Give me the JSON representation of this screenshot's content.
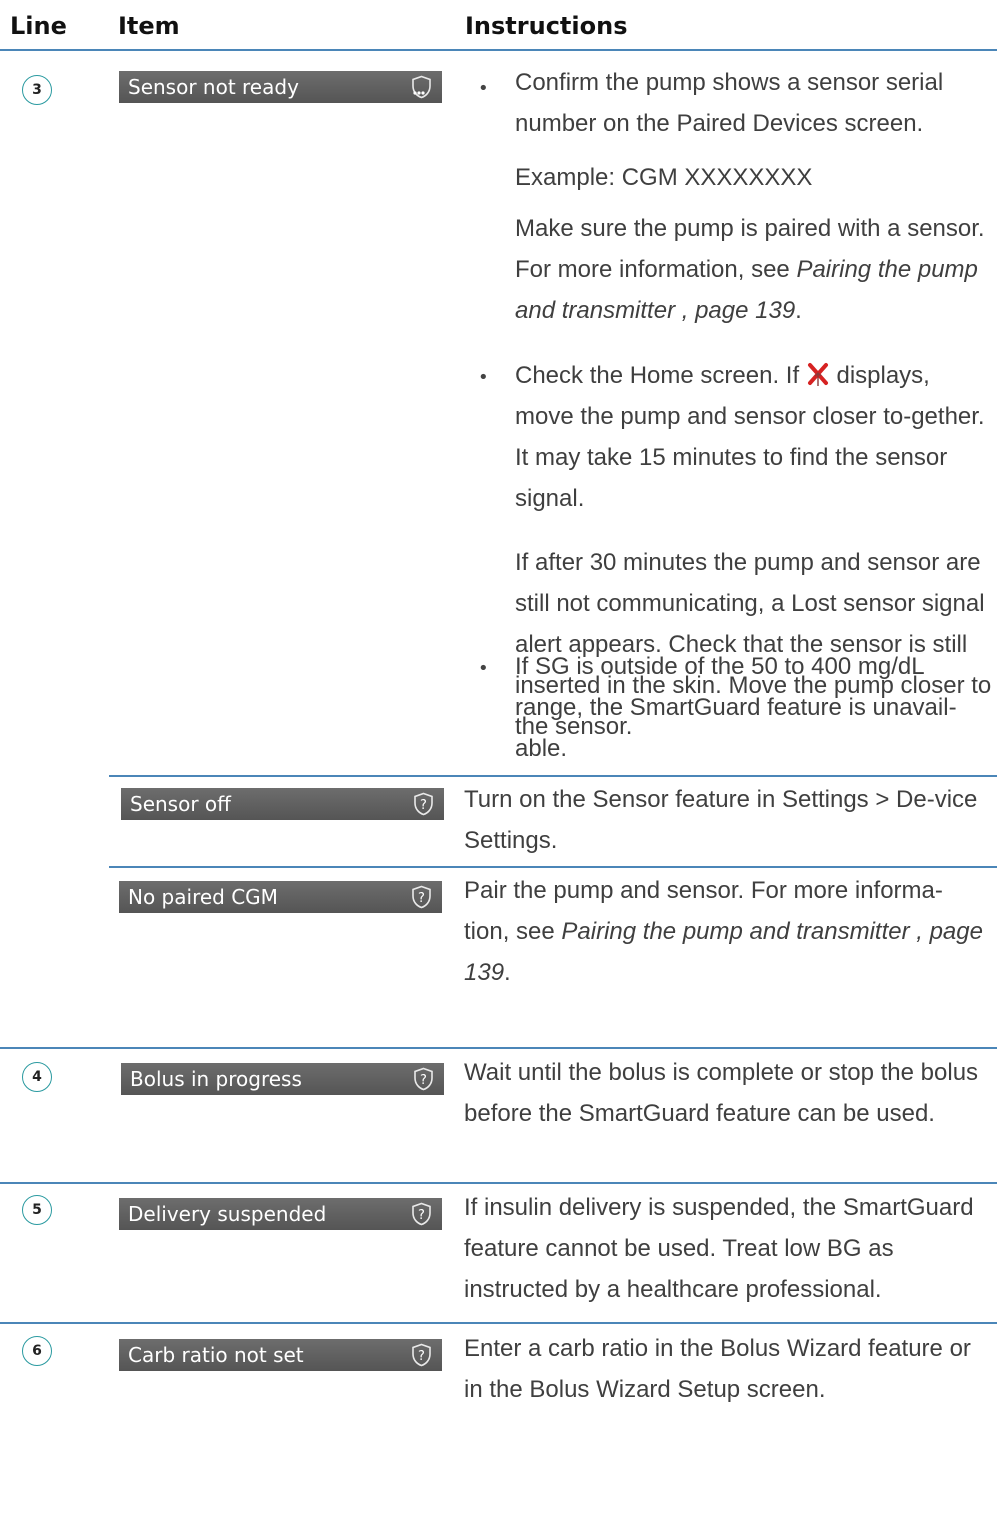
{
  "header": {
    "line": "Line",
    "item": "Item",
    "instructions": "Instructions"
  },
  "rows": [
    {
      "line": "3",
      "item": "Sensor not ready",
      "item_icon": "sensor-waiting-icon",
      "bullets": [
        {
          "p1": "Confirm the pump shows a sensor serial number on the Paired Devices screen.",
          "p2": "Example: CGM XXXXXXXX",
          "p3_prefix": "Make sure the pump is paired with a sensor. For more information, see ",
          "p3_link": "Pairing the pump and transmitter , page 139",
          "p3_suffix": "."
        },
        {
          "p1_prefix": "Check the Home screen. If ",
          "p1_icon": "lost-signal-icon",
          "p1_suffix": " displays, move the pump and sensor closer to-gether. It may take 15 minutes to find the sensor signal.",
          "p2": "If after 30 minutes the pump and sensor are still not communicating, a Lost sensor signal alert appears. Check that the sensor is still inserted in the skin. Move the pump closer to the sensor."
        },
        {
          "p1": "If SG is outside of the 50 to 400 mg/dL range, the SmartGuard feature is unavail-able."
        }
      ]
    },
    {
      "item": "Sensor off",
      "item_icon": "help-icon",
      "text": "Turn on the Sensor feature in Settings > De-vice Settings."
    },
    {
      "item": "No paired CGM",
      "item_icon": "help-icon",
      "text_prefix": "Pair the pump and sensor. For more informa-tion, see ",
      "text_link": "Pairing the pump and transmitter , page 139",
      "text_suffix": "."
    },
    {
      "line": "4",
      "item": "Bolus in progress",
      "item_icon": "help-icon",
      "text": "Wait until the bolus is complete or stop the bolus before the SmartGuard feature can be used."
    },
    {
      "line": "5",
      "item": "Delivery suspended",
      "item_icon": "help-icon",
      "text": "If insulin delivery is suspended, the SmartGuard feature cannot be used. Treat low BG as instructed by a healthcare professional."
    },
    {
      "line": "6",
      "item": "Carb ratio not set",
      "item_icon": "help-icon",
      "text": "Enter a carb ratio in the Bolus Wizard feature or in the Bolus Wizard Setup screen."
    }
  ],
  "colors": {
    "rule": "#4b86b8",
    "chip": "#5e5e5e",
    "circle": "#2a9aa0",
    "icon_red": "#d62222"
  }
}
